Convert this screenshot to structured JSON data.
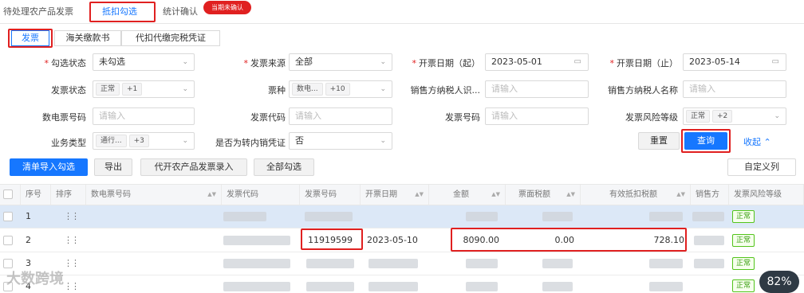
{
  "top_tabs": [
    {
      "label": "待处理农产品发票"
    },
    {
      "label": "抵扣勾选"
    },
    {
      "label": "统计确认"
    }
  ],
  "top_badge": "当期未确认",
  "sub_tabs": [
    "发票",
    "海关缴款书",
    "代扣代缴完税凭证"
  ],
  "filters": {
    "check_status": {
      "label": "勾选状态",
      "value": "未勾选"
    },
    "invoice_source": {
      "label": "发票来源",
      "value": "全部"
    },
    "date_start": {
      "label": "开票日期（起）",
      "value": "2023-05-01"
    },
    "date_end": {
      "label": "开票日期（止）",
      "value": "2023-05-14"
    },
    "invoice_status": {
      "label": "发票状态",
      "tag": "正常",
      "more": "+1"
    },
    "ticket_type": {
      "label": "票种",
      "tag": "数电...",
      "more": "+10"
    },
    "seller_tax_id": {
      "label": "销售方纳税人识...",
      "placeholder": "请输入"
    },
    "seller_name": {
      "label": "销售方纳税人名称",
      "placeholder": "请输入"
    },
    "digital_no": {
      "label": "数电票号码",
      "placeholder": "请输入"
    },
    "invoice_code": {
      "label": "发票代码",
      "placeholder": "请输入"
    },
    "invoice_no": {
      "label": "发票号码",
      "placeholder": "请输入"
    },
    "risk_level": {
      "label": "发票风险等级",
      "tag": "正常",
      "more": "+2"
    },
    "biz_type": {
      "label": "业务类型",
      "tag": "通行...",
      "more": "+3"
    },
    "transfer_voucher": {
      "label": "是否为转内销凭证",
      "value": "否"
    }
  },
  "buttons": {
    "reset": "重置",
    "query": "查询",
    "collapse": "收起",
    "import_check": "清单导入勾选",
    "export": "导出",
    "agri_entry": "代开农产品发票录入",
    "check_all": "全部勾选",
    "custom_cols": "自定义列"
  },
  "table": {
    "columns": [
      "序号",
      "排序",
      "数电票号码",
      "发票代码",
      "发票号码",
      "开票日期",
      "金额",
      "票面税额",
      "有效抵扣税额",
      "销售方",
      "发票风险等级"
    ],
    "rows": [
      {
        "index": "1",
        "invoice_no": "",
        "date": "",
        "amount": "",
        "tax": "",
        "deductible": "",
        "risk": "正常"
      },
      {
        "index": "2",
        "invoice_no": "11919599",
        "date": "2023-05-10",
        "amount": "8090.00",
        "tax": "0.00",
        "deductible": "728.10",
        "risk": "正常"
      },
      {
        "index": "3",
        "invoice_no": "",
        "date": "",
        "amount": "",
        "tax": "",
        "deductible": "",
        "risk": "正常"
      },
      {
        "index": "4",
        "invoice_no": "",
        "date": "",
        "amount": "",
        "tax": "",
        "deductible": "",
        "risk": "正常"
      }
    ]
  },
  "watermark": "大数跨境",
  "zoom_level": "82%",
  "colors": {
    "accent": "#1677ff",
    "highlight_border": "#e02020",
    "status_green": "#52c41a"
  }
}
